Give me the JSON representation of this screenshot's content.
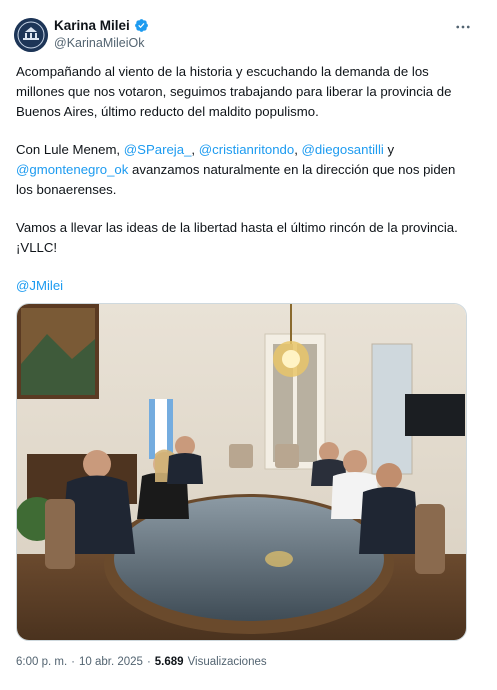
{
  "author": {
    "display_name": "Karina Milei",
    "handle": "@KarinaMileiOk"
  },
  "tweet": {
    "paragraph_1": "Acompañando al viento de la historia y escuchando la demanda de los millones que nos votaron, seguimos trabajando para liberar la provincia de Buenos Aires, último reducto del maldito populismo.",
    "paragraph_2": {
      "prefix": "Con Lule Menem, ",
      "mention_1": "@SPareja_",
      "sep_1": ", ",
      "mention_2": "@cristianritondo",
      "sep_2": ", ",
      "mention_3": "@diegosantilli",
      "sep_3": " y ",
      "mention_4": "@gmontenegro_ok",
      "suffix": " avanzamos naturalmente en la dirección que nos piden los bonaerenses."
    },
    "paragraph_3": "Vamos a llevar las ideas de la libertad hasta el último rincón de la provincia. ¡VLLC!",
    "paragraph_4_mention": "@JMilei"
  },
  "footer": {
    "time": "6:00 p. m.",
    "separator": "·",
    "date": "10 abr. 2025",
    "views_count": "5.689",
    "views_label": "Visualizaciones"
  },
  "icons": {
    "verified": "verified-badge-icon",
    "more": "more-options-icon"
  },
  "colors": {
    "accent": "#1d9bf0",
    "text": "#0f1419",
    "secondary": "#536471"
  }
}
